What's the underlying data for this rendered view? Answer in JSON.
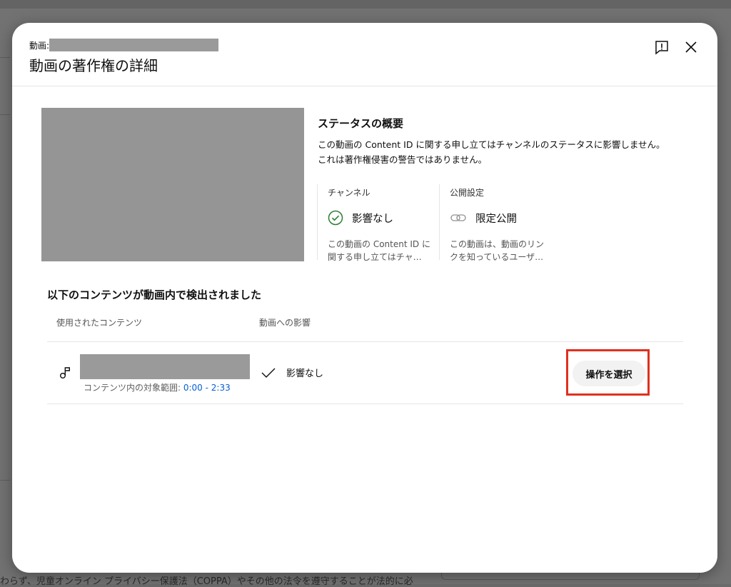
{
  "background": {
    "footer_text": "わらず、児童オンライン プライバシー保護法（COPPA）やその他の法令を遵守することが法的に必"
  },
  "dialog": {
    "video_label": "動画:",
    "title": "動画の著作権の詳細",
    "icons": {
      "feedback": "feedback-icon",
      "close": "close-icon"
    }
  },
  "status": {
    "title": "ステータスの概要",
    "line1": "この動画の Content ID に関する申し立てはチャンネルのステータスに影響しません。",
    "line2": "これは著作権侵害の警告ではありません。",
    "channel": {
      "label": "チャンネル",
      "value": "影響なし",
      "desc1": "この動画の Content ID に",
      "desc2": "関する申し立てはチャ…"
    },
    "visibility": {
      "label": "公開設定",
      "value": "限定公開",
      "desc1": "この動画は、動画のリン",
      "desc2": "クを知っているユーザ…"
    }
  },
  "content": {
    "section_title": "以下のコンテンツが動画内で検出されました",
    "columns": [
      "使用されたコンテンツ",
      "動画への影響"
    ],
    "rows": [
      {
        "range_label": "コンテンツ内の対象範囲: ",
        "range": "0:00 - 2:33",
        "impact": "影響なし",
        "action": "操作を選択"
      }
    ]
  },
  "colors": {
    "accent_link": "#065fd4",
    "highlight": "#e0301e",
    "success": "#2e7d32"
  }
}
